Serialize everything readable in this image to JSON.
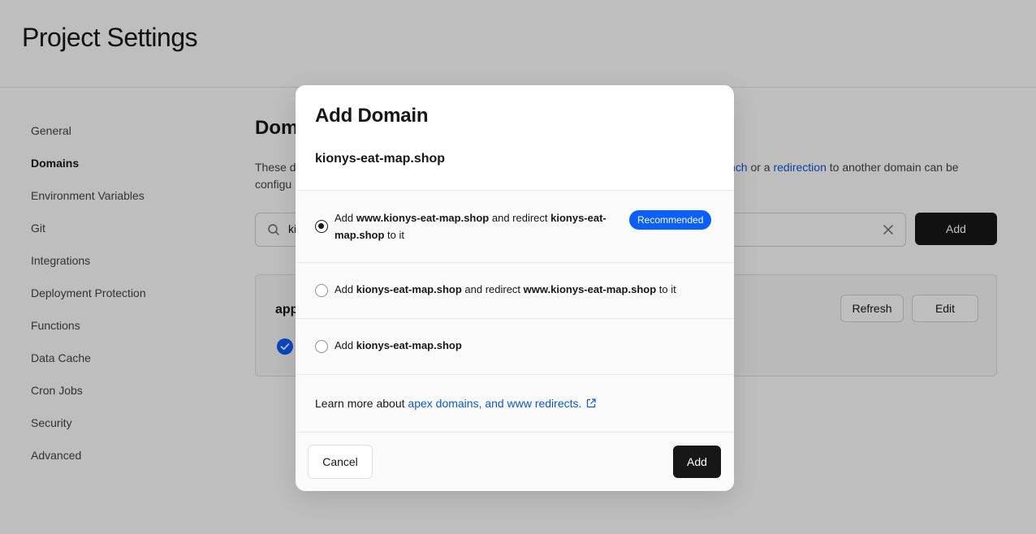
{
  "page": {
    "title": "Project Settings"
  },
  "sidebar": {
    "items": [
      {
        "label": "General"
      },
      {
        "label": "Domains"
      },
      {
        "label": "Environment Variables"
      },
      {
        "label": "Git"
      },
      {
        "label": "Integrations"
      },
      {
        "label": "Deployment Protection"
      },
      {
        "label": "Functions"
      },
      {
        "label": "Data Cache"
      },
      {
        "label": "Cron Jobs"
      },
      {
        "label": "Security"
      },
      {
        "label": "Advanced"
      }
    ],
    "active": "Domains"
  },
  "main": {
    "section_title_visible": "Dom",
    "desc_line1_start": "These d",
    "desc_link1_fragment": "nch",
    "desc_middle": " or a ",
    "desc_link2": "redirection",
    "desc_end": " to another domain can be",
    "desc_line2_start": "configu",
    "search_value_visible": "ki",
    "add_button": "Add",
    "card": {
      "name_visible": "app",
      "refresh_button": "Refresh",
      "edit_button": "Edit"
    }
  },
  "modal": {
    "title": "Add Domain",
    "domain": "kionys-eat-map.shop",
    "options": [
      {
        "prefix": "Add ",
        "bold1": "www.kionys-eat-map.shop",
        "middle": " and redirect ",
        "bold2": "kionys-eat-map.shop",
        "suffix": " to it",
        "badge": "Recommended",
        "selected": true
      },
      {
        "prefix": "Add ",
        "bold1": "kionys-eat-map.shop",
        "middle": " and redirect ",
        "bold2": "www.kionys-eat-map.shop",
        "suffix": " to it",
        "selected": false
      },
      {
        "prefix": "Add ",
        "bold1": "kionys-eat-map.shop",
        "selected": false
      }
    ],
    "learn_more_prefix": "Learn more about ",
    "learn_more_link": "apex domains, and www redirects.",
    "cancel_button": "Cancel",
    "add_button": "Add"
  },
  "colors": {
    "accent": "#0b5fff",
    "link": "#0a58d6",
    "primary_button": "#171717"
  },
  "icons": [
    "search-icon",
    "clear-icon",
    "check-circle-icon",
    "external-link-icon"
  ]
}
